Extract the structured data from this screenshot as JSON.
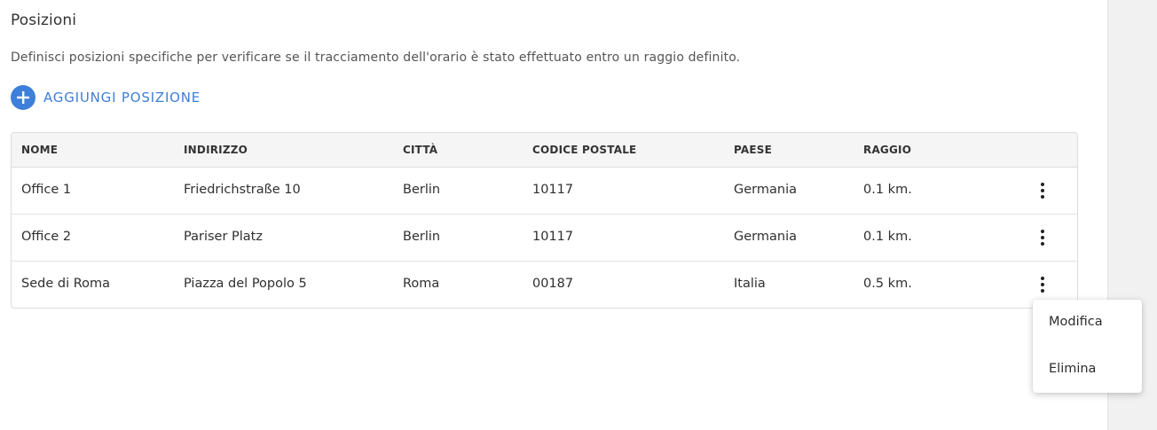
{
  "section": {
    "title": "Posizioni",
    "description": "Definisci posizioni specifiche per verificare se il tracciamento dell'orario è stato effettuato entro un raggio definito."
  },
  "add_button": {
    "label": "AGGIUNGI POSIZIONE",
    "icon": "plus-circle-icon"
  },
  "table": {
    "headers": [
      "NOME",
      "INDIRIZZO",
      "CITTÀ",
      "CODICE POSTALE",
      "PAESE",
      "RAGGIO"
    ],
    "rows": [
      [
        "Office 1",
        "Friedrichstraße 10",
        "Berlin",
        "10117",
        "Germania",
        "0.1 km."
      ],
      [
        "Office 2",
        "Pariser Platz",
        "Berlin",
        "10117",
        "Germania",
        "0.1 km."
      ],
      [
        "Sede di Roma",
        "Piazza del Popolo 5",
        "Roma",
        "00187",
        "Italia",
        "0.5 km."
      ]
    ]
  },
  "context_menu": {
    "items": [
      {
        "label": "Modifica"
      },
      {
        "label": "Elimina"
      }
    ]
  },
  "colors": {
    "accent": "#3d7fd9",
    "header_bg": "#f5f5f5",
    "side_panel": "#f1f1f1"
  }
}
